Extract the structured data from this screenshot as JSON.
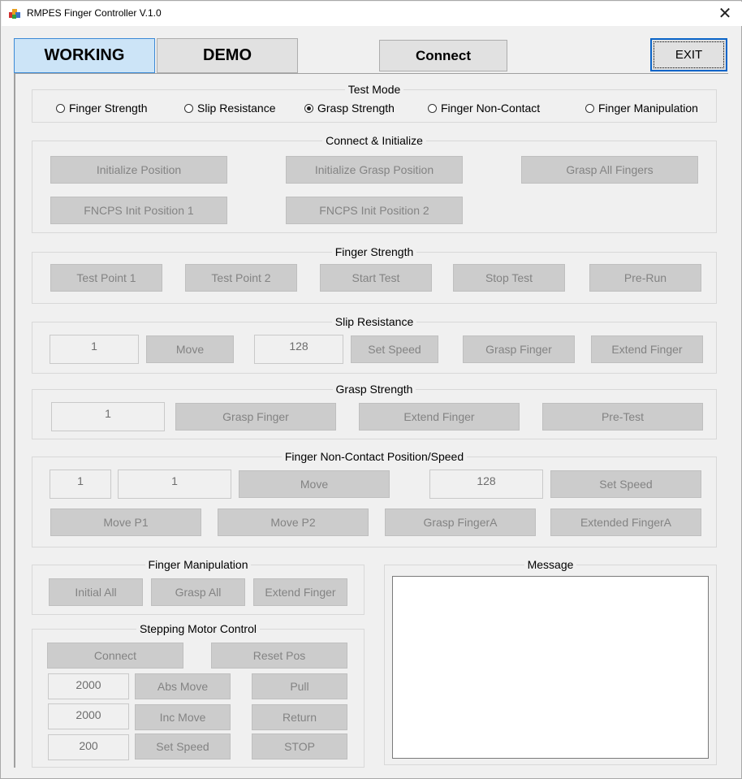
{
  "window": {
    "title": "RMPES Finger Controller V.1.0",
    "close_glyph": "✕",
    "icon": "app-icon"
  },
  "top": {
    "working": "WORKING",
    "demo": "DEMO",
    "connect": "Connect",
    "exit": "EXIT"
  },
  "test_mode": {
    "title": "Test Mode",
    "options": [
      {
        "label": "Finger Strength",
        "selected": false
      },
      {
        "label": "Slip Resistance",
        "selected": false
      },
      {
        "label": "Grasp Strength",
        "selected": true
      },
      {
        "label": "Finger Non-Contact",
        "selected": false
      },
      {
        "label": "Finger Manipulation",
        "selected": false
      }
    ]
  },
  "connect_init": {
    "title": "Connect & Initialize",
    "buttons": [
      "Initialize Position",
      "Initialize Grasp Position",
      "Grasp All Fingers",
      "FNCPS Init Position 1",
      "FNCPS Init Position 2"
    ]
  },
  "finger_strength": {
    "title": "Finger Strength",
    "buttons": [
      "Test Point 1",
      "Test Point 2",
      "Start Test",
      "Stop Test",
      "Pre-Run"
    ]
  },
  "slip_resistance": {
    "title": "Slip Resistance",
    "position_value": "1",
    "move": "Move",
    "speed_value": "128",
    "set_speed": "Set Speed",
    "grasp_finger": "Grasp Finger",
    "extend_finger": "Extend Finger"
  },
  "grasp_strength": {
    "title": "Grasp Strength",
    "value": "1",
    "grasp_finger": "Grasp Finger",
    "extend_finger": "Extend Finger",
    "pre_test": "Pre-Test"
  },
  "non_contact": {
    "title": "Finger Non-Contact Position/Speed",
    "value1": "1",
    "value2": "1",
    "move": "Move",
    "speed_value": "128",
    "set_speed": "Set Speed",
    "move_p1": "Move P1",
    "move_p2": "Move P2",
    "grasp_finger_a": "Grasp FingerA",
    "extended_finger_a": "Extended FingerA"
  },
  "manipulation": {
    "title": "Finger Manipulation",
    "initial_all": "Initial All",
    "grasp_all": "Grasp All",
    "extend_finger": "Extend Finger"
  },
  "stepping_motor": {
    "title": "Stepping Motor Control",
    "connect": "Connect",
    "reset_pos": "Reset Pos",
    "abs_value": "2000",
    "abs_move": "Abs Move",
    "pull": "Pull",
    "inc_value": "2000",
    "inc_move": "Inc Move",
    "return": "Return",
    "speed_value": "200",
    "set_speed": "Set Speed",
    "stop": "STOP"
  },
  "message": {
    "title": "Message",
    "content": ""
  }
}
